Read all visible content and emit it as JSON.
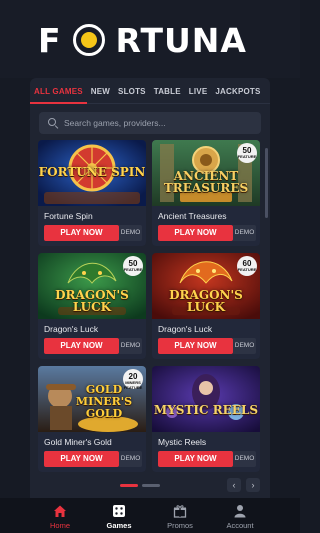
{
  "brand": {
    "logo_text_left": "F",
    "logo_text_right": "RTUNA",
    "accent": "#e8333f",
    "logo_dot": "#f5c518"
  },
  "tabs": [
    {
      "label": "ALL GAMES",
      "active": true
    },
    {
      "label": "NEW"
    },
    {
      "label": "SLOTS"
    },
    {
      "label": "TABLE"
    },
    {
      "label": "LIVE"
    },
    {
      "label": "JACKPOTS"
    }
  ],
  "search": {
    "placeholder": "Search games, providers..."
  },
  "games": [
    {
      "name": "Fortune Spin",
      "art_title": "Fortune Spin",
      "play_label": "PLAY NOW",
      "demo_label": "DEMO"
    },
    {
      "name": "Ancient Treasures",
      "art_title": "Ancient Treasures",
      "badge_num": "50",
      "badge_text": "FEATURE",
      "play_label": "PLAY NOW",
      "demo_label": "DEMO"
    },
    {
      "name": "Dragon's Luck",
      "art_title": "Dragon's Luck",
      "badge_num": "50",
      "badge_text": "FEATURE",
      "play_label": "PLAY NOW",
      "demo_label": "DEMO"
    },
    {
      "name": "Dragon's Luck",
      "art_title": "Dragon's Luck",
      "badge_num": "60",
      "badge_text": "FEATURE",
      "play_label": "PLAY NOW",
      "demo_label": "DEMO"
    },
    {
      "name": "Gold Miner's Gold",
      "art_title": "Gold Miner's Gold",
      "badge_num": "20",
      "badge_text": "MINERS FEATURE",
      "play_label": "PLAY NOW",
      "demo_label": "DEMO"
    },
    {
      "name": "Mystic Reels",
      "art_title": "Mystic Reels",
      "play_label": "PLAY NOW",
      "demo_label": "DEMO"
    }
  ],
  "pager": {
    "prev": "‹",
    "next": "›"
  },
  "bottom_nav": [
    {
      "label": "Home",
      "icon": "home-icon",
      "active": true
    },
    {
      "label": "Games",
      "icon": "games-icon"
    },
    {
      "label": "Promos",
      "icon": "gift-icon"
    },
    {
      "label": "Account",
      "icon": "user-icon"
    }
  ]
}
